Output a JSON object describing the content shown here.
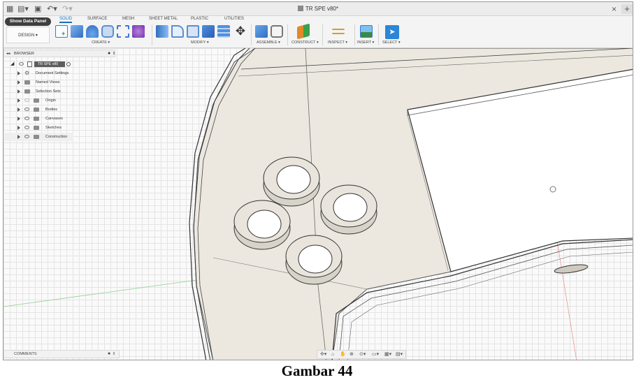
{
  "window": {
    "document_title": "TR SPE v80*",
    "close_tab": "×",
    "new_tab": "+"
  },
  "toolbar": {
    "show_data_panel": "Show Data Panel",
    "workspace": "DESIGN ▾",
    "tabs": [
      "SOLID",
      "SURFACE",
      "MESH",
      "SHEET METAL",
      "PLASTIC",
      "UTILITIES"
    ],
    "groups": {
      "create": "CREATE ▾",
      "modify": "MODIFY ▾",
      "assemble": "ASSEMBLE ▾",
      "construct": "CONSTRUCT ▾",
      "inspect": "INSPECT ▾",
      "insert": "INSERT ▾",
      "select": "SELECT ▾"
    },
    "accent": "#1a6fc0"
  },
  "browser": {
    "header": "BROWSER",
    "root": "TR SPE v80",
    "items": [
      {
        "label": "Document Settings",
        "icon": "gear-icon"
      },
      {
        "label": "Named Views",
        "icon": "folder-icon"
      },
      {
        "label": "Selection Sets",
        "icon": "folder-icon"
      },
      {
        "label": "Origin",
        "icon": "folder-icon"
      },
      {
        "label": "Bodies",
        "icon": "folder-icon"
      },
      {
        "label": "Canvases",
        "icon": "folder-icon"
      },
      {
        "label": "Sketches",
        "icon": "folder-icon"
      },
      {
        "label": "Construction",
        "icon": "folder-icon"
      }
    ]
  },
  "comments": {
    "label": "COMMENTS"
  },
  "navbar": {
    "icons": [
      "orbit-icon",
      "look-at-icon",
      "pan-icon",
      "zoom-icon",
      "fit-icon",
      "display-icon",
      "visual-style-icon",
      "grid-icon"
    ]
  },
  "caption": "Gambar 44"
}
